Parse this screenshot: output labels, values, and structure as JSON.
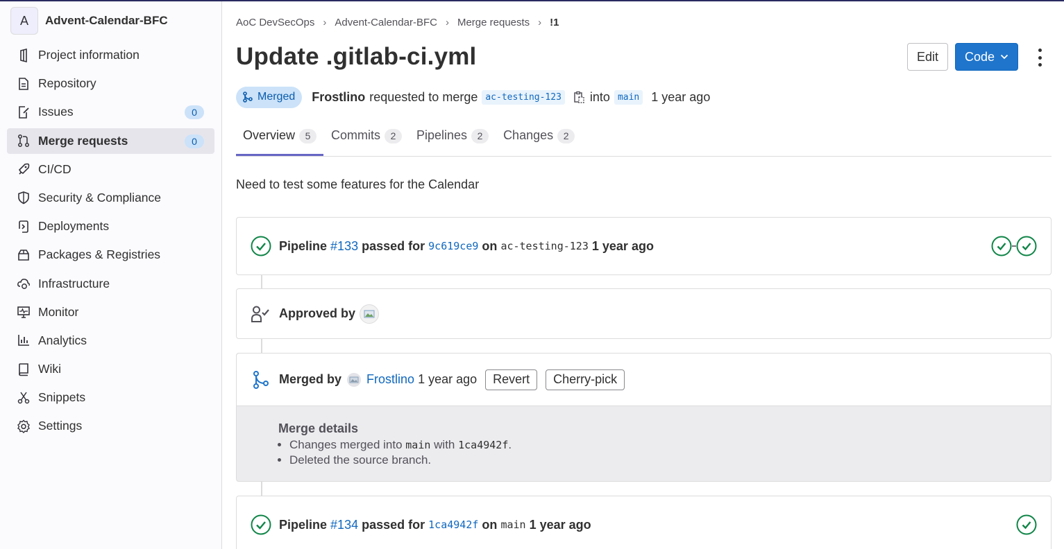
{
  "project": {
    "avatar_letter": "A",
    "name": "Advent-Calendar-BFC"
  },
  "sidebar": {
    "items": [
      {
        "label": "Project information",
        "icon": "project-info-icon"
      },
      {
        "label": "Repository",
        "icon": "repository-icon"
      },
      {
        "label": "Issues",
        "icon": "issues-icon",
        "count": "0"
      },
      {
        "label": "Merge requests",
        "icon": "merge-request-icon",
        "count": "0",
        "active": true
      },
      {
        "label": "CI/CD",
        "icon": "rocket-icon"
      },
      {
        "label": "Security & Compliance",
        "icon": "shield-icon"
      },
      {
        "label": "Deployments",
        "icon": "deployments-icon"
      },
      {
        "label": "Packages & Registries",
        "icon": "package-icon"
      },
      {
        "label": "Infrastructure",
        "icon": "cloud-gear-icon"
      },
      {
        "label": "Monitor",
        "icon": "monitor-icon"
      },
      {
        "label": "Analytics",
        "icon": "chart-icon"
      },
      {
        "label": "Wiki",
        "icon": "book-icon"
      },
      {
        "label": "Snippets",
        "icon": "scissors-icon"
      },
      {
        "label": "Settings",
        "icon": "gear-icon"
      }
    ]
  },
  "breadcrumbs": [
    "AoC DevSecOps",
    "Advent-Calendar-BFC",
    "Merge requests",
    "!1"
  ],
  "mr": {
    "title": "Update .gitlab-ci.yml",
    "edit_label": "Edit",
    "code_label": "Code",
    "status": "Merged",
    "author": "Frostlino",
    "requested_text": "requested to merge",
    "source_branch": "ac-testing-123",
    "into_text": "into",
    "target_branch": "main",
    "time": "1 year ago"
  },
  "tabs": [
    {
      "label": "Overview",
      "count": "5",
      "active": true
    },
    {
      "label": "Commits",
      "count": "2"
    },
    {
      "label": "Pipelines",
      "count": "2"
    },
    {
      "label": "Changes",
      "count": "2"
    }
  ],
  "description": "Need to test some features for the Calendar",
  "pipeline1": {
    "label": "Pipeline",
    "id": "#133",
    "passed_for": "passed for",
    "sha": "9c619ce9",
    "on": "on",
    "branch": "ac-testing-123",
    "time": "1 year ago"
  },
  "approval": {
    "label": "Approved by"
  },
  "merged": {
    "label": "Merged by",
    "user": "Frostlino",
    "time": "1 year ago",
    "revert_label": "Revert",
    "cherry_pick_label": "Cherry-pick",
    "details_title": "Merge details",
    "detail1_a": "Changes merged into",
    "detail1_branch": "main",
    "detail1_b": "with",
    "detail1_sha": "1ca4942f",
    "detail1_c": ".",
    "detail2": "Deleted the source branch."
  },
  "pipeline2": {
    "label": "Pipeline",
    "id": "#134",
    "passed_for": "passed for",
    "sha": "1ca4942f",
    "on": "on",
    "branch": "main",
    "time": "1 year ago"
  },
  "colors": {
    "success": "#108548",
    "link": "#1068bf",
    "primary": "#1f75cb",
    "badge_blue": "#cbe2f9"
  }
}
